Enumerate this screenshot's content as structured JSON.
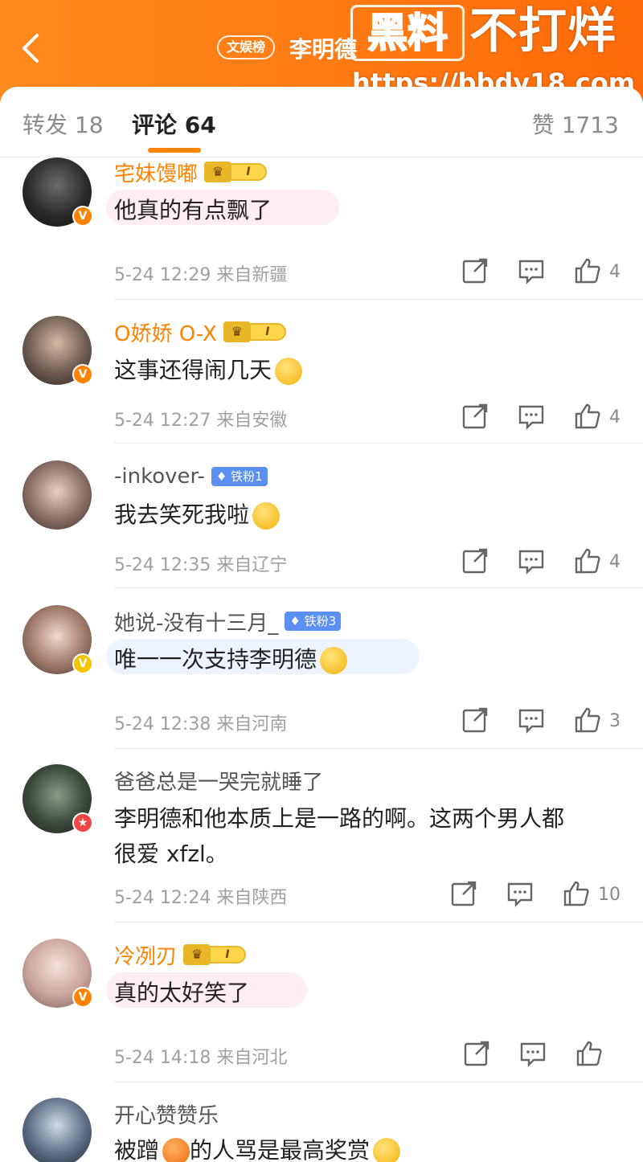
{
  "header": {
    "tag": "文娱榜",
    "title": "李明德",
    "watermark_box": "黑料",
    "watermark_main": "不打烊",
    "watermark_url": "https://bbdy18.com"
  },
  "tabs": {
    "repost": "转发 18",
    "comments": "评论 64",
    "likes": "赞 1713"
  },
  "colors": {
    "accent": "#ff8200",
    "vip_name": "#ff8200"
  },
  "comments": [
    {
      "user": "宅妹馒嘟",
      "vip": true,
      "level": "I",
      "text": "他真的有点飘了",
      "time": "5-24 12:29",
      "location": "来自新疆",
      "likes": "4",
      "avatar_badge": "orange"
    },
    {
      "user": "O娇娇 O-X",
      "vip": true,
      "level": "I",
      "text": "这事还得闹几天",
      "time": "5-24 12:27",
      "location": "来自安徽",
      "likes": "4",
      "avatar_badge": "orange"
    },
    {
      "user": "-inkover-",
      "vip": false,
      "fan_badge": "铁粉1",
      "text": "我去笑死我啦",
      "time": "5-24 12:35",
      "location": "来自辽宁",
      "likes": "4"
    },
    {
      "user": "她说-没有十三月_",
      "vip": false,
      "fan_badge": "铁粉3",
      "text": "唯一一次支持李明德",
      "time": "5-24 12:38",
      "location": "来自河南",
      "likes": "3",
      "avatar_badge": "yellow"
    },
    {
      "user": "爸爸总是一哭完就睡了",
      "vip": false,
      "text_line1": "李明德和他本质上是一路的啊。这两个男人都",
      "text_line2": "很爱 xfzl。",
      "time": "5-24 12:24",
      "location": "来自陕西",
      "likes": "10",
      "avatar_badge": "red"
    },
    {
      "user": "冷冽刃",
      "vip": true,
      "level": "I",
      "text": "真的太好笑了",
      "time": "5-24 14:18",
      "location": "来自河北",
      "likes": "",
      "avatar_badge": "orange"
    },
    {
      "user": "开心赞赞乐",
      "vip": false,
      "text_a": "被蹭",
      "text_b": "的人骂是最高奖赏"
    }
  ]
}
